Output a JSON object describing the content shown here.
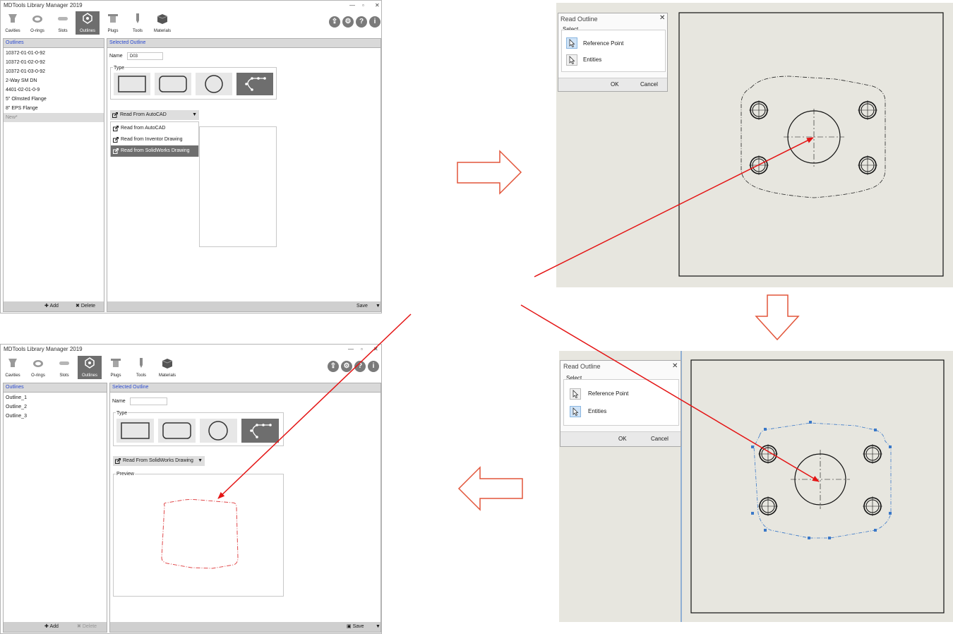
{
  "app": {
    "title": "MDTools Library Manager 2019",
    "toolbar": [
      "Cavities",
      "O-rings",
      "Slots",
      "Outlines",
      "Plugs",
      "Tools",
      "Materials"
    ],
    "active_tab": "Outlines",
    "right_icons": [
      "import-icon",
      "gear-icon",
      "help-icon",
      "info-icon"
    ]
  },
  "window_top": {
    "outlines_header": "Outlines",
    "outlines": [
      "10372-01-01-0-92",
      "10372-01-02-0-92",
      "10372-01-03-0-92",
      "2-Way SM DN",
      "4401-02-01-0-9",
      "5\" Olmsted Flange",
      "8\" EPS Flange",
      "New*"
    ],
    "selected_header": "Selected Outline",
    "name_label": "Name",
    "name_value": "D03",
    "type_label": "Type",
    "dropdown_value": "Read From AutoCAD",
    "menu_items": [
      "Read from AutoCAD",
      "Read from Inventor Drawing",
      "Read from SolidWorks Drawing"
    ],
    "menu_highlight": "Read from SolidWorks Drawing",
    "add_label": "Add",
    "delete_label": "Delete",
    "save_label": "Save"
  },
  "window_bottom": {
    "outlines_header": "Outlines",
    "outlines": [
      "Outline_1",
      "Outline_2",
      "Outline_3"
    ],
    "selected_header": "Selected Outline",
    "name_label": "Name",
    "name_value": "",
    "type_label": "Type",
    "dropdown_value": "Read From SolidWorks Drawing",
    "preview_label": "Preview",
    "add_label": "Add",
    "delete_label": "Delete",
    "save_label": "Save"
  },
  "dialog_1": {
    "title": "Read Outline",
    "select_label": "Select",
    "options": [
      "Reference Point",
      "Entities"
    ],
    "active_option": "Reference Point",
    "ok_label": "OK",
    "cancel_label": "Cancel"
  },
  "dialog_2": {
    "title": "Read Outline",
    "select_label": "Select",
    "options": [
      "Reference Point",
      "Entities"
    ],
    "active_option": "Entities",
    "ok_label": "OK",
    "cancel_label": "Cancel"
  },
  "colors": {
    "flow_arrow": "#e2553a",
    "pointer_arrow": "#e41515",
    "preview_outline": "#e0484a",
    "selected_entity": "#3a78c8"
  }
}
